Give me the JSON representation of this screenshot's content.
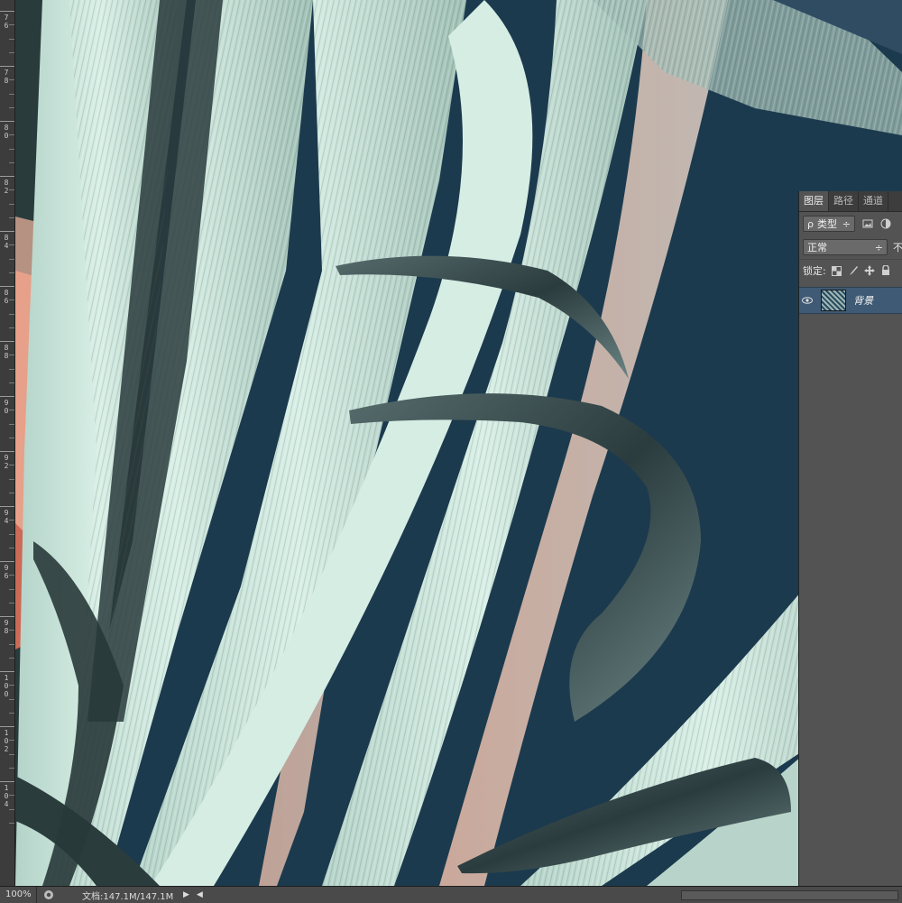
{
  "ruler": {
    "labels": [
      "76",
      "78",
      "80",
      "82",
      "84",
      "86",
      "88",
      "90",
      "92",
      "94",
      "96",
      "98",
      "100",
      "102",
      "104"
    ]
  },
  "status": {
    "zoom": "100%",
    "doc": "文档:147.1M/147.1M",
    "arrow": "▶",
    "left_arrow": "◀"
  },
  "layers_panel": {
    "tabs": [
      {
        "label": "图层"
      },
      {
        "label": "路径"
      },
      {
        "label": "通道"
      }
    ],
    "filter": {
      "icon_label": "ρ",
      "value": "类型",
      "arrows": "÷"
    },
    "blend": {
      "value": "正常",
      "arrows": "÷",
      "opacity_cut": "不"
    },
    "lock": {
      "label": "锁定:"
    },
    "layer": {
      "name": "背景"
    }
  },
  "colors": {
    "canvas_bg": "#1c3a4e",
    "leaf_light": "#c9e6da",
    "leaf_mid": "#7fa39a",
    "leaf_dark": "#2a3d3f",
    "peach": "#f2b8a0",
    "coral": "#e8735a",
    "panel": "#535353",
    "selected_layer": "#3f5a74"
  }
}
